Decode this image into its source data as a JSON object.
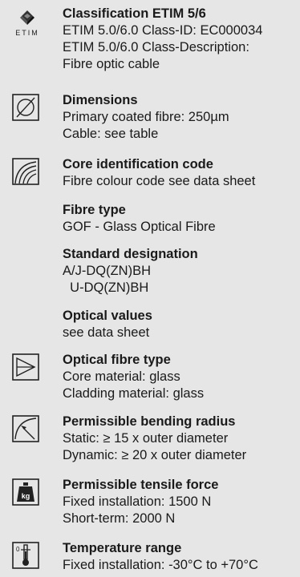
{
  "sections": [
    {
      "icon": "etim-logo-icon",
      "icon_text": "ETIM",
      "title": "Classification ETIM 5/6",
      "lines": [
        "ETIM 5.0/6.0 Class-ID: EC000034",
        "ETIM 5.0/6.0 Class-Description:",
        "Fibre optic cable"
      ]
    },
    {
      "icon": "diameter-icon",
      "title": "Dimensions",
      "lines": [
        "Primary coated fibre: 250µm",
        "Cable: see table"
      ]
    },
    {
      "icon": "core-identification-icon",
      "title": "Core identification code",
      "lines": [
        "Fibre colour code see data sheet"
      ]
    },
    {
      "icon": "",
      "title": "Fibre type",
      "lines": [
        "GOF - Glass Optical Fibre"
      ]
    },
    {
      "icon": "",
      "title": "Standard designation",
      "lines": [
        "A/J-DQ(ZN)BH",
        "  U-DQ(ZN)BH"
      ]
    },
    {
      "icon": "",
      "title": "Optical values",
      "lines": [
        "see data sheet"
      ]
    },
    {
      "icon": "optical-fibre-type-icon",
      "title": "Optical fibre type",
      "lines": [
        "Core material: glass",
        "Cladding material: glass"
      ]
    },
    {
      "icon": "bending-radius-icon",
      "title": "Permissible bending radius",
      "lines": [
        "Static: ≥ 15 x outer diameter",
        "Dynamic: ≥ 20 x outer diameter"
      ]
    },
    {
      "icon": "tensile-force-weight-icon",
      "icon_text": "kg",
      "title": "Permissible tensile force",
      "lines": [
        "Fixed installation: 1500 N",
        "Short-term: 2000 N"
      ]
    },
    {
      "icon": "temperature-thermometer-icon",
      "icon_text": "0",
      "title": "Temperature range",
      "lines": [
        "Fixed installation: -30°C to +70°C"
      ]
    }
  ]
}
